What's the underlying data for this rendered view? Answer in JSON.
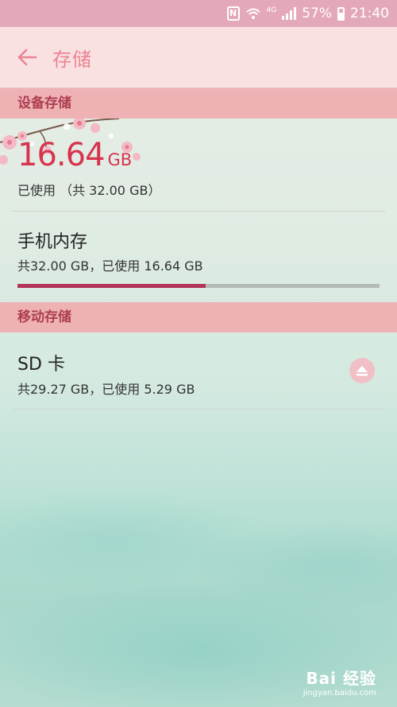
{
  "status_bar": {
    "network_label": "4G",
    "battery": "57%",
    "time": "21:40"
  },
  "app_bar": {
    "title": "存储"
  },
  "device_storage": {
    "header": "设备存储",
    "used_number": "16.64",
    "used_unit": "GB",
    "used_subtitle": "已使用 （共 32.00 GB）",
    "phone_memory": {
      "title": "手机内存",
      "subtitle": "共32.00 GB，已使用 16.64 GB",
      "used_fraction": 0.52
    }
  },
  "mobile_storage": {
    "header": "移动存储",
    "sd_card": {
      "title": "SD 卡",
      "subtitle": "共29.27 GB，已使用 5.29 GB"
    }
  },
  "watermark": {
    "brand": "Bai 经验",
    "url": "jingyan.baidu.com"
  },
  "colors": {
    "accent": "#d8334e",
    "progress_fill": "#b33459",
    "section_bg": "#eeb1b4",
    "app_bar_bg": "#f9e1e2",
    "status_bar_bg": "#e4a9b8"
  }
}
